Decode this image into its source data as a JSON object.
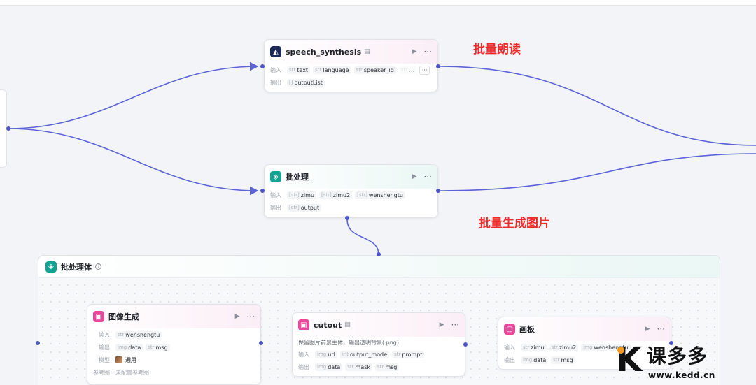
{
  "annotations": {
    "batch_read": "批量朗读",
    "batch_image": "批量生成图片"
  },
  "speech_node": {
    "title": "speech_synthesis",
    "input_label": "输入",
    "output_label": "输出",
    "inputs": [
      {
        "type": "str",
        "name": "text"
      },
      {
        "type": "str",
        "name": "language"
      },
      {
        "type": "str",
        "name": "speaker_id"
      },
      {
        "type": "str",
        "name": "..."
      }
    ],
    "more_label": "···",
    "outputs": [
      {
        "type": "[]",
        "name": "outputList"
      }
    ]
  },
  "batch_node": {
    "title": "批处理",
    "input_label": "输入",
    "output_label": "输出",
    "inputs": [
      {
        "type": "[str]",
        "name": "zimu"
      },
      {
        "type": "[str]",
        "name": "zimu2"
      },
      {
        "type": "[str]",
        "name": "wenshengtu"
      }
    ],
    "outputs": [
      {
        "type": "[str]",
        "name": "output"
      }
    ]
  },
  "batch_body": {
    "title": "批处理体"
  },
  "image_node": {
    "title": "图像生成",
    "input_label": "输入",
    "output_label": "输出",
    "model_label": "模型",
    "ref_label": "参考图",
    "inputs": [
      {
        "type": "str",
        "name": "wenshengtu"
      }
    ],
    "outputs": [
      {
        "type": "img",
        "name": "data"
      },
      {
        "type": "str",
        "name": "msg"
      }
    ],
    "model_value": "通用",
    "ref_value": "未配置参考图"
  },
  "cutout_node": {
    "title": "cutout",
    "description": "保留图片前景主体，输出透明背景(.png)",
    "input_label": "输入",
    "output_label": "输出",
    "inputs": [
      {
        "type": "img",
        "name": "url"
      },
      {
        "type": "int",
        "name": "output_mode"
      },
      {
        "type": "str",
        "name": "prompt"
      }
    ],
    "outputs": [
      {
        "type": "img",
        "name": "data"
      },
      {
        "type": "str",
        "name": "mask"
      },
      {
        "type": "str",
        "name": "msg"
      }
    ]
  },
  "canvas_node": {
    "title": "画板",
    "input_label": "输入",
    "output_label": "输出",
    "inputs": [
      {
        "type": "str",
        "name": "zimu"
      },
      {
        "type": "str",
        "name": "zimu2"
      },
      {
        "type": "img",
        "name": "wenshengtu"
      }
    ],
    "outputs": [
      {
        "type": "img",
        "name": "data"
      },
      {
        "type": "str",
        "name": "msg"
      }
    ]
  },
  "common": {
    "run_icon": "▶",
    "more_icon": "···"
  },
  "brand": {
    "name": "课多多",
    "url": "www.kedd.cn"
  },
  "colors": {
    "wire": "#5b63d6",
    "annotation": "#ee2b2b",
    "accent_pink": "#e8489b",
    "accent_teal": "#14a392"
  }
}
